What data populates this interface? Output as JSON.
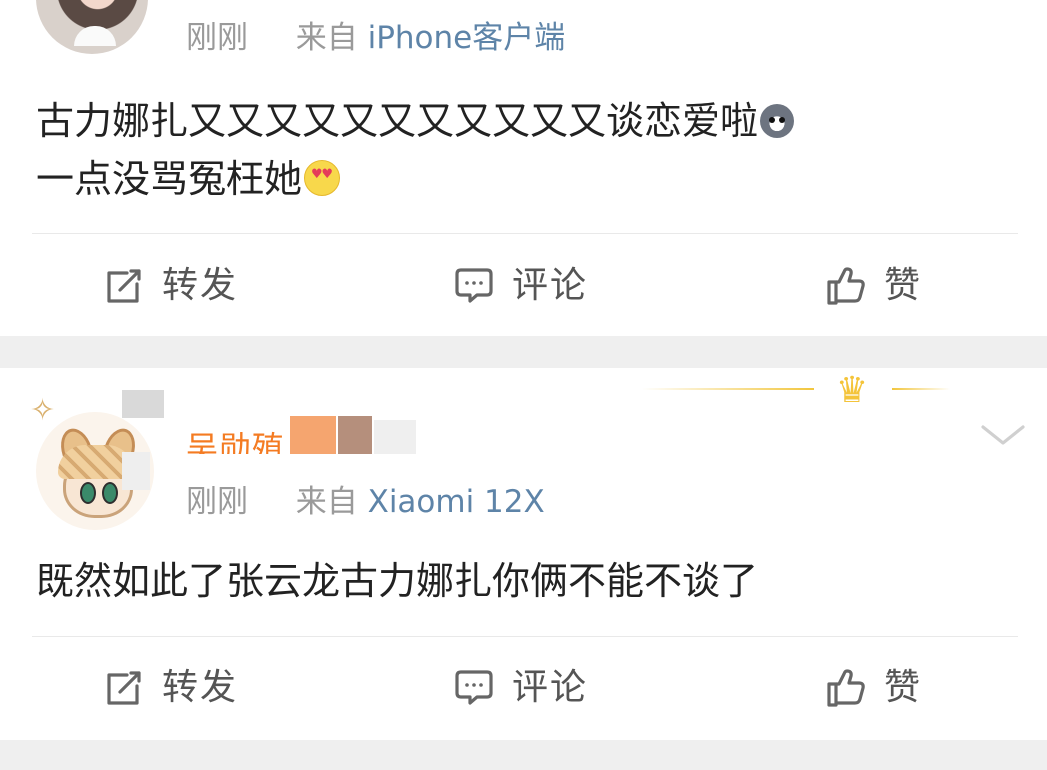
{
  "feed": {
    "posts": [
      {
        "meta": {
          "time": "刚刚",
          "source_prefix": "来自",
          "source_app": "iPhone客户端"
        },
        "content": {
          "line_1": "古力娜扎又又又又又又又又又又又谈恋爱啦",
          "line_2": "一点没骂冤枉她"
        },
        "emojis": [
          "husky-emoji",
          "heart-eyes-emoji"
        ],
        "actions": {
          "repost": "转发",
          "comment": "评论",
          "like": "赞"
        }
      },
      {
        "user": {
          "nickname_visible_fragment": "吴勋殖"
        },
        "meta": {
          "time": "刚刚",
          "source_prefix": "来自",
          "source_app": "Xiaomi 12X"
        },
        "content": {
          "line_1": "既然如此了张云龙古力娜扎你俩不能不谈了"
        },
        "actions": {
          "repost": "转发",
          "comment": "评论",
          "like": "赞"
        }
      }
    ]
  },
  "icons": {
    "repost": "repost-icon",
    "comment": "comment-icon",
    "like": "like-icon",
    "more": "chevron-down-icon",
    "crown": "crown-icon"
  },
  "colors": {
    "background": "#f2f2f2",
    "card": "#ffffff",
    "text": "#222222",
    "meta": "#9a9a9a",
    "source_link": "#5e84a8",
    "nickname": "#f47b22",
    "crown": "#f4c43a"
  }
}
